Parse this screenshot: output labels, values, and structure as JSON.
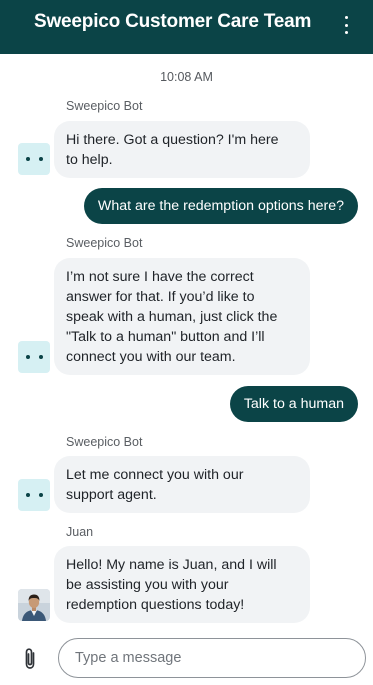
{
  "header": {
    "title": "Sweepico Customer Care Team",
    "menu_icon": "more-vertical-icon"
  },
  "chat": {
    "timestamp": "10:08 AM",
    "messages": [
      {
        "sender": "Sweepico Bot",
        "direction": "incoming",
        "lines": [
          "Hi there. Got a question? I'm here",
          "to help."
        ]
      },
      {
        "direction": "outgoing",
        "text": "What are the redemption options here?"
      },
      {
        "sender": "Sweepico Bot",
        "direction": "incoming",
        "lines": [
          "I’m not sure I have the correct",
          "answer for that. If you’d like to",
          "speak with a human, just click the",
          "\"Talk to a human\" button and I’ll",
          "connect you with our team."
        ]
      },
      {
        "direction": "outgoing",
        "text": "Talk to a human"
      },
      {
        "sender": "Sweepico Bot",
        "direction": "incoming",
        "lines": [
          "Let me connect you with our",
          "support agent."
        ]
      },
      {
        "sender": "Juan",
        "direction": "incoming",
        "lines": [
          "Hello! My name is Juan, and I will",
          "be assisting you with your",
          "redemption questions today!"
        ]
      }
    ]
  },
  "composer": {
    "placeholder": "Type a message",
    "value": "",
    "attach_icon": "paperclip-icon"
  },
  "colors": {
    "brand": "#0b4447",
    "incoming_bubble": "#f1f3f5",
    "bot_avatar_bg": "#d6f0f3"
  }
}
